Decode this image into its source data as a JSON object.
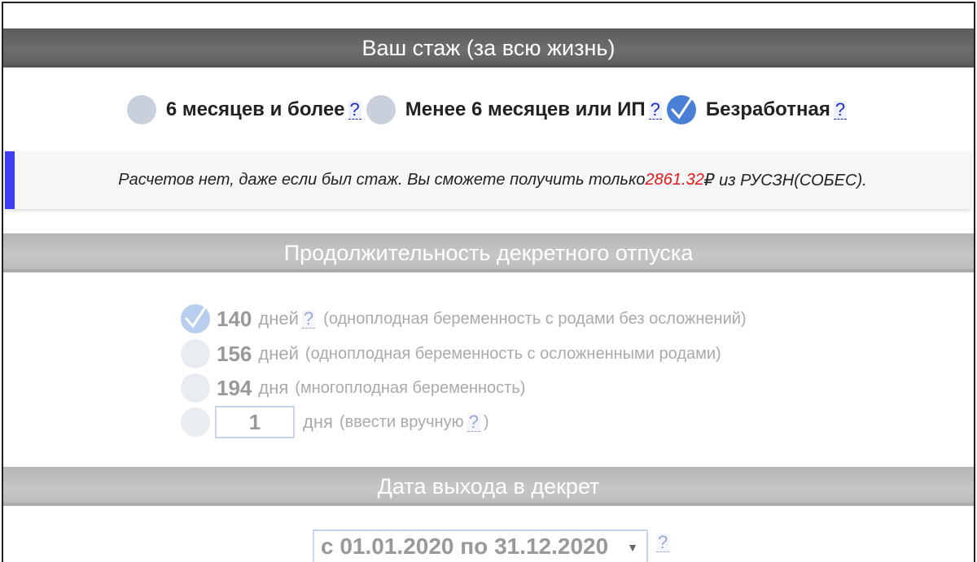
{
  "stazh": {
    "title": "Ваш стаж (за всю жизнь)",
    "options": [
      {
        "label": "6 месяцев и более",
        "checked": false
      },
      {
        "label": "Менее 6 месяцев или ИП",
        "checked": false
      },
      {
        "label": "Безработная",
        "checked": true
      }
    ],
    "help_glyph": "?"
  },
  "notice": {
    "text_before": "Расчетов нет, даже если был стаж. Вы сможете получить только ",
    "amount": "2861.32",
    "text_after": " ₽ из РУСЗН(СОБЕС).",
    "accent_color": "#3d3df2",
    "amount_color": "#e01a1a"
  },
  "duration": {
    "title": "Продолжительность декретного отпуска",
    "options": [
      {
        "num": "140",
        "unit": "дней",
        "desc": "(одноплодная беременность с родами без осложнений)",
        "checked": true,
        "has_help": true
      },
      {
        "num": "156",
        "unit": "дней",
        "desc": "(одноплодная беременность с осложненными родами)",
        "checked": false
      },
      {
        "num": "194",
        "unit": "дня",
        "desc": "(многоплодная беременность)",
        "checked": false
      }
    ],
    "manual": {
      "value": "1",
      "unit": "дня",
      "desc_before": "(ввести вручную",
      "desc_after": ")"
    }
  },
  "decree_date": {
    "title": "Дата выхода в декрет",
    "selected": "с 01.01.2020 по 31.12.2020"
  }
}
